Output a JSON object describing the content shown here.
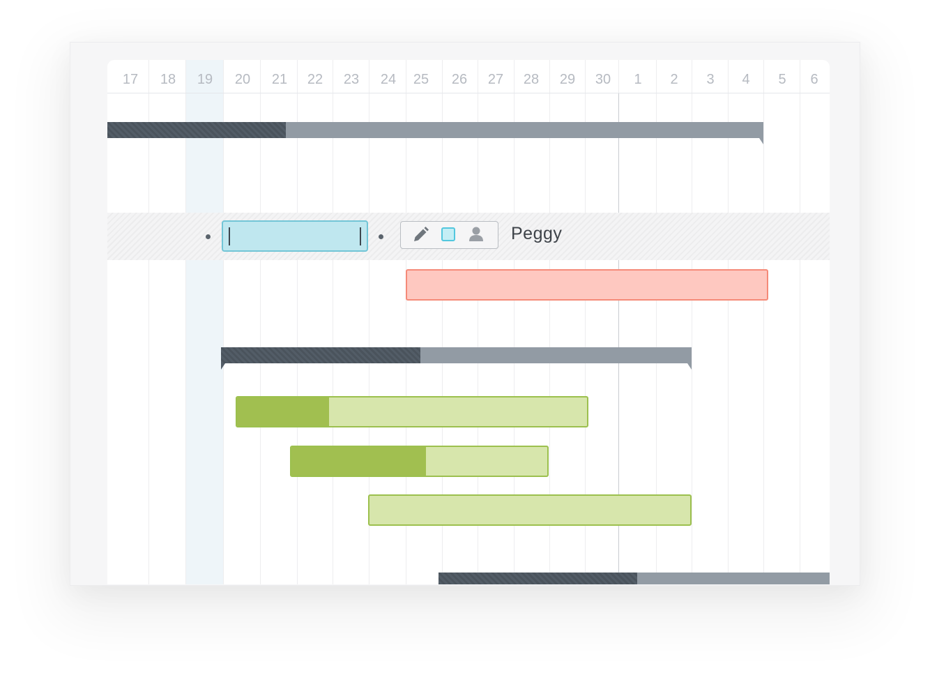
{
  "timeline": {
    "days": [
      "17",
      "18",
      "19",
      "20",
      "21",
      "22",
      "23",
      "24",
      "25",
      "26",
      "27",
      "28",
      "29",
      "30",
      "1",
      "2",
      "3",
      "4",
      "5",
      "6"
    ],
    "today": "19",
    "current_marker_after": "30"
  },
  "edit_row": {
    "task_name_value": "",
    "toolbar": {
      "edit_icon": "pencil-icon",
      "color_icon": "color-swatch-icon",
      "assign_icon": "person-icon",
      "swatch_color": "#52c7de"
    },
    "assignee": "Peggy"
  },
  "colors": {
    "summary_bar": "#929ba4",
    "summary_done": "#535d67",
    "red_task": "#fec8c0",
    "green_task": "#d7e6ac",
    "green_progress": "#a1bf50",
    "today_highlight": "#eef5f9"
  }
}
